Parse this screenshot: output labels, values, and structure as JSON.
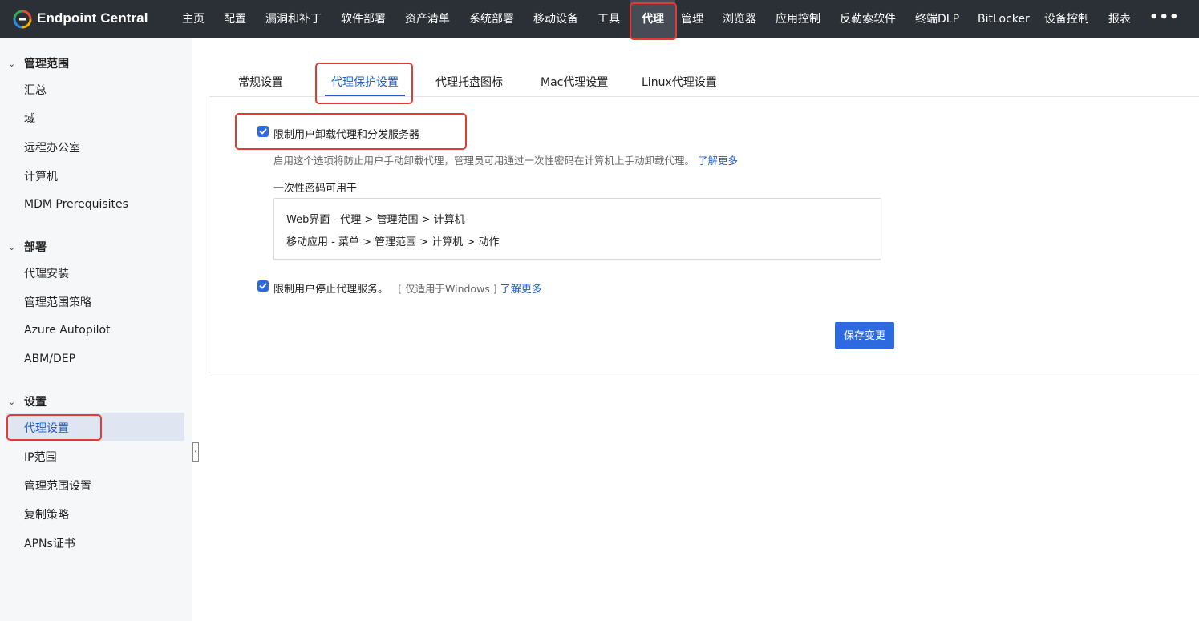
{
  "app": {
    "brand": "Endpoint Central"
  },
  "nav": {
    "items": [
      "主页",
      "配置",
      "漏洞和补丁",
      "软件部署",
      "资产清单",
      "系统部署",
      "移动设备",
      "工具",
      "代理",
      "管理",
      "浏览器",
      "应用控制",
      "反勒索软件",
      "终端DLP",
      "BitLocker",
      "设备控制",
      "报表"
    ],
    "active": "代理",
    "more": "•••"
  },
  "sidebar": {
    "sections": [
      {
        "title": "管理范围",
        "items": [
          "汇总",
          "域",
          "远程办公室",
          "计算机",
          "MDM Prerequisites"
        ]
      },
      {
        "title": "部署",
        "items": [
          "代理安装",
          "管理范围策略",
          "Azure Autopilot",
          "ABM/DEP"
        ]
      },
      {
        "title": "设置",
        "items": [
          "代理设置",
          "IP范围",
          "管理范围设置",
          "复制策略",
          "APNs证书"
        ]
      }
    ],
    "active_item": "代理设置"
  },
  "tabs": [
    "常规设置",
    "代理保护设置",
    "代理托盘图标",
    "Mac代理设置",
    "Linux代理设置"
  ],
  "active_tab": "代理保护设置",
  "protection": {
    "uninstall_option": {
      "label": "限制用户卸载代理和分发服务器",
      "checked": true,
      "description": "启用这个选项将防止用户手动卸载代理，管理员可用通过一次性密码在计算机上手动卸载代理。",
      "learn_more": "了解更多"
    },
    "otp": {
      "label": "一次性密码可用于",
      "lines": [
        "Web界面 - 代理 > 管理范围 > 计算机",
        "移动应用 - 菜单 > 管理范围 > 计算机 > 动作"
      ]
    },
    "stop_option": {
      "label": "限制用户停止代理服务。",
      "checked": true,
      "note": "[ 仅适用于Windows ]",
      "learn_more": "了解更多"
    },
    "save_label": "保存变更"
  },
  "colors": {
    "accent": "#2d6ae0",
    "topbar": "#2b3036",
    "highlight": "#e53935"
  }
}
